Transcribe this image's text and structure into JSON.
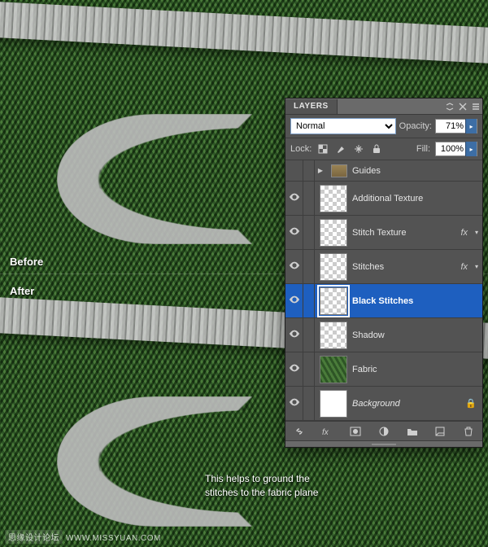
{
  "backdrop": {
    "before_label": "Before",
    "after_label": "After",
    "caption_line1": "This helps to ground the",
    "caption_line2": "stitches to the fabric plane",
    "watermark_tag": "思缘设计论坛",
    "watermark_url": "WWW.MISSYUAN.COM"
  },
  "panel": {
    "title": "LAYERS",
    "blend_mode_options": [
      "Normal"
    ],
    "blend_mode_value": "Normal",
    "opacity_label": "Opacity:",
    "opacity_value": "71%",
    "lock_label": "Lock:",
    "fill_label": "Fill:",
    "fill_value": "100%",
    "layers": [
      {
        "kind": "group",
        "name": "Guides",
        "visible": false
      },
      {
        "kind": "layer",
        "name": "Additional Texture",
        "thumb": "checker"
      },
      {
        "kind": "layer",
        "name": "Stitch Texture",
        "thumb": "checker",
        "fx": true
      },
      {
        "kind": "layer",
        "name": "Stitches",
        "thumb": "checker",
        "fx": true
      },
      {
        "kind": "layer",
        "name": "Black Stitches",
        "thumb": "checker",
        "selected": true
      },
      {
        "kind": "layer",
        "name": "Shadow",
        "thumb": "checker"
      },
      {
        "kind": "layer",
        "name": "Fabric",
        "thumb": "green"
      },
      {
        "kind": "layer",
        "name": "Background",
        "thumb": "white",
        "italic": true,
        "locked": true
      }
    ],
    "footer_icons": [
      "link",
      "fx-menu",
      "mask",
      "adjust",
      "group-new",
      "new-layer",
      "trash"
    ]
  }
}
